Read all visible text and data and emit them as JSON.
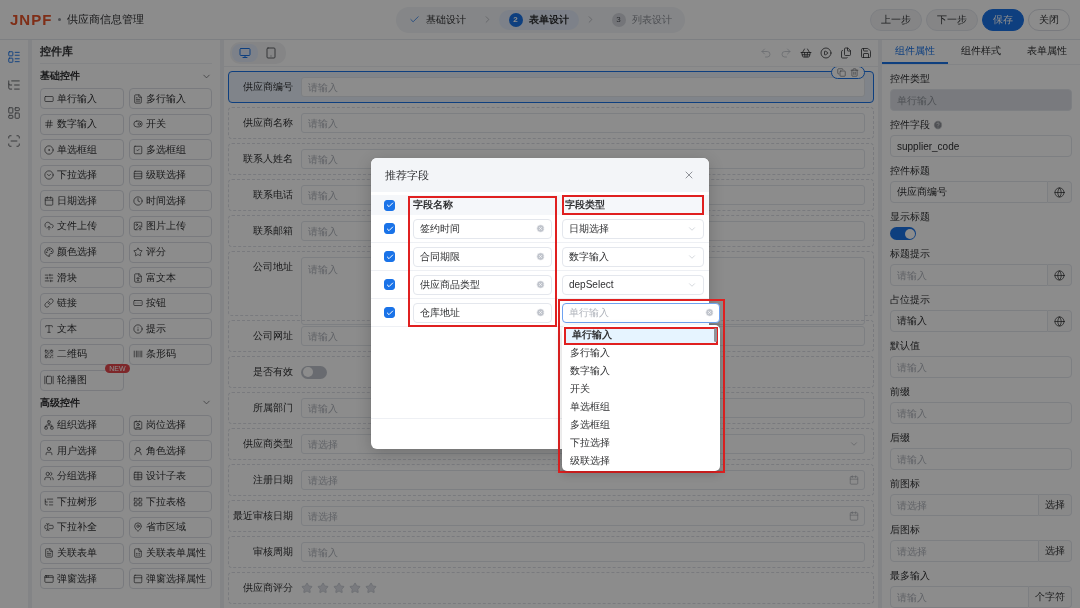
{
  "header": {
    "logo": "JNPF",
    "title": "供应商信息管理",
    "steps": [
      {
        "label": "基础设计",
        "done": true,
        "selected": false
      },
      {
        "number": "2",
        "label": "表单设计",
        "done": false,
        "selected": true
      },
      {
        "number": "3",
        "label": "列表设计",
        "done": false,
        "selected": false
      }
    ],
    "buttons": [
      {
        "label": "上一步",
        "kind": "default"
      },
      {
        "label": "下一步",
        "kind": "default"
      },
      {
        "label": "保存",
        "kind": "primary"
      },
      {
        "label": "关闭",
        "kind": "plain"
      }
    ]
  },
  "rail": [
    {
      "kind": "components",
      "selected": true
    },
    {
      "kind": "tree",
      "selected": false
    },
    {
      "kind": "layout",
      "selected": false
    },
    {
      "kind": "scan",
      "selected": false
    }
  ],
  "palette": {
    "title": "控件库",
    "groups": [
      {
        "title": "基础控件",
        "expanded": true,
        "items": [
          {
            "label": "单行输入",
            "kind": "input"
          },
          {
            "label": "多行输入",
            "kind": "textarea"
          },
          {
            "label": "数字输入",
            "kind": "number"
          },
          {
            "label": "开关",
            "kind": "switch"
          },
          {
            "label": "单选框组",
            "kind": "radio"
          },
          {
            "label": "多选框组",
            "kind": "checkbox"
          },
          {
            "label": "下拉选择",
            "kind": "select"
          },
          {
            "label": "级联选择",
            "kind": "cascader"
          },
          {
            "label": "日期选择",
            "kind": "date"
          },
          {
            "label": "时间选择",
            "kind": "time"
          },
          {
            "label": "文件上传",
            "kind": "upload"
          },
          {
            "label": "图片上传",
            "kind": "image"
          },
          {
            "label": "颜色选择",
            "kind": "color"
          },
          {
            "label": "评分",
            "kind": "rate"
          },
          {
            "label": "滑块",
            "kind": "slider"
          },
          {
            "label": "富文本",
            "kind": "richtext"
          },
          {
            "label": "链接",
            "kind": "link"
          },
          {
            "label": "按钮",
            "kind": "button"
          },
          {
            "label": "文本",
            "kind": "text"
          },
          {
            "label": "提示",
            "kind": "alert"
          },
          {
            "label": "二维码",
            "kind": "qrcode"
          },
          {
            "label": "条形码",
            "kind": "barcode"
          },
          {
            "label": "轮播图",
            "kind": "carousel",
            "badge": "NEW"
          }
        ]
      },
      {
        "title": "高级控件",
        "expanded": true,
        "items": [
          {
            "label": "组织选择",
            "kind": "org"
          },
          {
            "label": "岗位选择",
            "kind": "post"
          },
          {
            "label": "用户选择",
            "kind": "user"
          },
          {
            "label": "角色选择",
            "kind": "role"
          },
          {
            "label": "分组选择",
            "kind": "group"
          },
          {
            "label": "设计子表",
            "kind": "table"
          },
          {
            "label": "下拉树形",
            "kind": "tree"
          },
          {
            "label": "下拉表格",
            "kind": "grid"
          },
          {
            "label": "下拉补全",
            "kind": "autocomplete"
          },
          {
            "label": "省市区域",
            "kind": "area"
          },
          {
            "label": "关联表单",
            "kind": "relation"
          },
          {
            "label": "关联表单属性",
            "kind": "relationattr"
          },
          {
            "label": "弹窗选择",
            "kind": "popup"
          },
          {
            "label": "弹窗选择属性",
            "kind": "popupattr"
          }
        ]
      }
    ]
  },
  "canvas": {
    "devices": [
      {
        "kind": "desktop",
        "selected": true
      },
      {
        "kind": "tablet",
        "selected": false
      }
    ],
    "tools": [
      {
        "kind": "undo",
        "disabled": true
      },
      {
        "kind": "redo",
        "disabled": true
      },
      {
        "kind": "clear",
        "disabled": false
      },
      {
        "kind": "preview",
        "disabled": false
      },
      {
        "kind": "code",
        "disabled": false
      },
      {
        "kind": "save",
        "disabled": false
      }
    ],
    "fields": [
      {
        "label": "供应商编号",
        "kind": "input",
        "placeholder": "请输入",
        "selected": true
      },
      {
        "label": "供应商名称",
        "kind": "input",
        "placeholder": "请输入",
        "selected": false
      },
      {
        "label": "联系人姓名",
        "kind": "input",
        "placeholder": "请输入",
        "selected": false
      },
      {
        "label": "联系电话",
        "kind": "input",
        "placeholder": "请输入",
        "selected": false
      },
      {
        "label": "联系邮箱",
        "kind": "input",
        "placeholder": "请输入",
        "selected": false
      },
      {
        "label": "公司地址",
        "kind": "textarea",
        "placeholder": "请输入",
        "selected": false
      },
      {
        "label": "公司网址",
        "kind": "input",
        "placeholder": "请输入",
        "selected": false
      },
      {
        "label": "是否有效",
        "kind": "switch",
        "on": false,
        "selected": false
      },
      {
        "label": "所属部门",
        "kind": "input",
        "placeholder": "请输入",
        "selected": false
      },
      {
        "label": "供应商类型",
        "kind": "select",
        "placeholder": "请选择",
        "selected": false
      },
      {
        "label": "注册日期",
        "kind": "date",
        "placeholder": "请选择",
        "selected": false
      },
      {
        "label": "最近审核日期",
        "kind": "date",
        "placeholder": "请选择",
        "selected": false
      },
      {
        "label": "审核周期",
        "kind": "input",
        "placeholder": "请输入",
        "selected": false
      },
      {
        "label": "供应商评分",
        "kind": "rate",
        "stars": 0,
        "selected": false
      }
    ]
  },
  "properties": {
    "tabs": [
      {
        "label": "组件属性",
        "selected": true
      },
      {
        "label": "组件样式",
        "selected": false
      },
      {
        "label": "表单属性",
        "selected": false
      }
    ],
    "items": [
      {
        "label": "控件类型",
        "kind": "input",
        "placeholder": "单行输入",
        "disabled": true
      },
      {
        "label": "控件字段",
        "kind": "input",
        "value": "supplier_code",
        "help": true
      },
      {
        "label": "控件标题",
        "kind": "input",
        "value": "供应商编号",
        "translatable": true
      },
      {
        "label": "显示标题",
        "kind": "switch",
        "on": true
      },
      {
        "label": "标题提示",
        "kind": "input",
        "placeholder": "请输入",
        "translatable": true
      },
      {
        "label": "占位提示",
        "kind": "input",
        "value": "请输入",
        "translatable": true
      },
      {
        "label": "默认值",
        "kind": "input",
        "placeholder": "请输入"
      },
      {
        "label": "前缀",
        "kind": "input",
        "placeholder": "请输入"
      },
      {
        "label": "后缀",
        "kind": "input",
        "placeholder": "请输入"
      },
      {
        "label": "前图标",
        "kind": "input",
        "placeholder": "请选择",
        "suffix": "选择"
      },
      {
        "label": "后图标",
        "kind": "input",
        "placeholder": "请选择",
        "suffix": "选择"
      },
      {
        "label": "最多输入",
        "kind": "input",
        "placeholder": "请输入",
        "suffix": "个字符"
      }
    ]
  },
  "dialog": {
    "title": "推荐字段",
    "all_checked": true,
    "columns": [
      "字段名称",
      "字段类型"
    ],
    "rows": [
      {
        "checked": true,
        "name": "签约时间",
        "type": "日期选择",
        "open": false
      },
      {
        "checked": true,
        "name": "合同期限",
        "type": "数字输入",
        "open": false
      },
      {
        "checked": true,
        "name": "供应商品类型",
        "type": "depSelect",
        "open": false
      },
      {
        "checked": true,
        "name": "仓库地址",
        "type_placeholder": "单行输入",
        "open": true
      }
    ],
    "options": [
      {
        "label": "单行输入",
        "selected": true
      },
      {
        "label": "多行输入",
        "selected": false
      },
      {
        "label": "数字输入",
        "selected": false
      },
      {
        "label": "开关",
        "selected": false
      },
      {
        "label": "单选框组",
        "selected": false
      },
      {
        "label": "多选框组",
        "selected": false
      },
      {
        "label": "下拉选择",
        "selected": false
      },
      {
        "label": "级联选择",
        "selected": false
      }
    ]
  }
}
